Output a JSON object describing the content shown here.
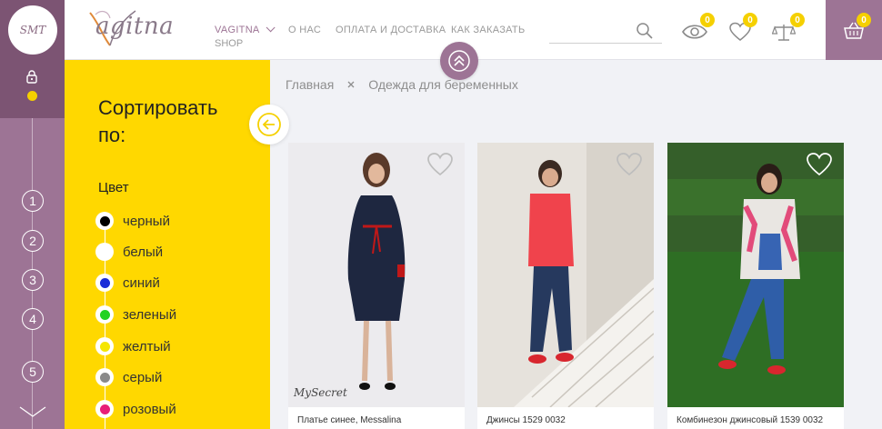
{
  "rail": {
    "logo_text": "SMT",
    "steps": [
      "1",
      "2",
      "3",
      "4",
      "5"
    ]
  },
  "header": {
    "logo_text": "agitna",
    "nav": {
      "shop_label": "VAGITNA",
      "shop_sub": "SHOP",
      "about": "О НАС",
      "payment": "ОПЛАТА И ДОСТАВКА",
      "howto": "КАК ЗАКАЗАТЬ"
    },
    "search_placeholder": "",
    "badges": {
      "viewed": "0",
      "favorites": "0",
      "compare": "0",
      "cart": "0"
    }
  },
  "filter": {
    "title": "Сортировать по:",
    "section": "Цвет",
    "colors": [
      {
        "label": "черный",
        "hex": "#000000"
      },
      {
        "label": "белый",
        "hex": "#ffffff"
      },
      {
        "label": "синий",
        "hex": "#1a2bd8"
      },
      {
        "label": "зеленый",
        "hex": "#22d222"
      },
      {
        "label": "желтый",
        "hex": "#f5e600"
      },
      {
        "label": "серый",
        "hex": "#8a8a8a"
      },
      {
        "label": "розовый",
        "hex": "#e81e78"
      }
    ]
  },
  "breadcrumbs": [
    "Главная",
    "Одежда для беременных"
  ],
  "products": [
    {
      "name": "Платье синее, Messalina",
      "watermark": "MySecret"
    },
    {
      "name": "Джинсы 1529 0032"
    },
    {
      "name": "Комбинезон джинсовый 1539 0032"
    }
  ],
  "colors": {
    "accent": "#9d7495",
    "accent_dark": "#7c5473",
    "yellow": "#ffd800",
    "badge": "#f5d000"
  }
}
